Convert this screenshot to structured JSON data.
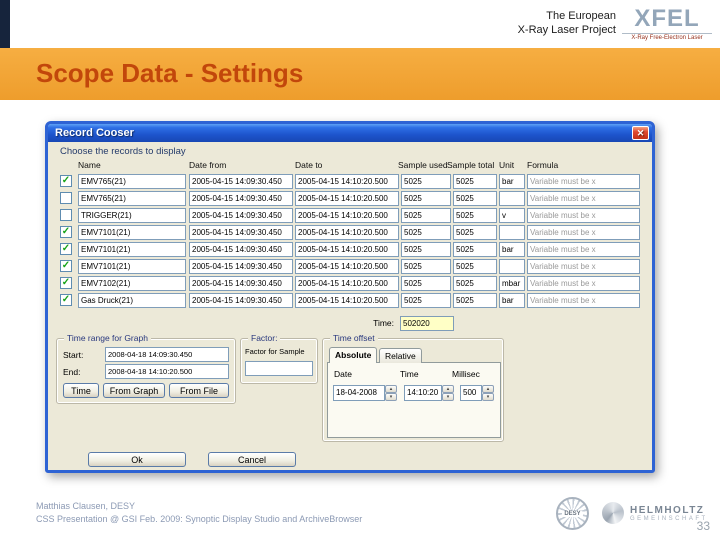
{
  "header": {
    "project_line1": "The European",
    "project_line2": "X-Ray Laser Project",
    "logo_text": "XFEL",
    "logo_caption": "X-Ray Free-Electron Laser",
    "title": "Scope Data - Settings"
  },
  "dialog": {
    "title": "Record Cooser",
    "close_glyph": "✕",
    "instruction": "Choose the records to display",
    "table": {
      "headers": [
        "Name",
        "Date from",
        "Date to",
        "Sample used",
        "Sample total",
        "Unit",
        "Formula"
      ],
      "rows": [
        {
          "checked": true,
          "name": "EMV765(21)",
          "date_from": "2005-04-15 14:09:30.450",
          "date_to": "2005-04-15 14:10:20.500",
          "sample_used": "5025",
          "sample_total": "5025",
          "unit": "bar",
          "formula": "Variable must be x"
        },
        {
          "checked": false,
          "name": "EMV765(21)",
          "date_from": "2005-04-15 14:09:30.450",
          "date_to": "2005-04-15 14:10:20.500",
          "sample_used": "5025",
          "sample_total": "5025",
          "unit": "",
          "formula": "Variable must be x"
        },
        {
          "checked": false,
          "name": "TRIGGER(21)",
          "date_from": "2005-04-15 14:09:30.450",
          "date_to": "2005-04-15 14:10:20.500",
          "sample_used": "5025",
          "sample_total": "5025",
          "unit": "v",
          "formula": "Variable must be x"
        },
        {
          "checked": true,
          "name": "EMV7101(21)",
          "date_from": "2005-04-15 14:09:30.450",
          "date_to": "2005-04-15 14:10:20.500",
          "sample_used": "5025",
          "sample_total": "5025",
          "unit": "",
          "formula": "Variable must be x"
        },
        {
          "checked": true,
          "name": "EMV7101(21)",
          "date_from": "2005-04-15 14:09:30.450",
          "date_to": "2005-04-15 14:10:20.500",
          "sample_used": "5025",
          "sample_total": "5025",
          "unit": "bar",
          "formula": "Variable must be x"
        },
        {
          "checked": true,
          "name": "EMV7101(21)",
          "date_from": "2005-04-15 14:09:30.450",
          "date_to": "2005-04-15 14:10:20.500",
          "sample_used": "5025",
          "sample_total": "5025",
          "unit": "",
          "formula": "Variable must be x"
        },
        {
          "checked": true,
          "name": "EMV7102(21)",
          "date_from": "2005-04-15 14:09:30.450",
          "date_to": "2005-04-15 14:10:20.500",
          "sample_used": "5025",
          "sample_total": "5025",
          "unit": "mbar",
          "formula": "Variable must be x"
        },
        {
          "checked": true,
          "name": "Gas Druck(21)",
          "date_from": "2005-04-15 14:09:30.450",
          "date_to": "2005-04-15 14:10:20.500",
          "sample_used": "5025",
          "sample_total": "5025",
          "unit": "bar",
          "formula": "Variable must be x"
        }
      ]
    },
    "time_label": "Time:",
    "time_value": "502020",
    "time_range_group": {
      "label": "Time range for Graph",
      "start_label": "Start:",
      "start_value": "2008-04-18 14:09:30.450",
      "end_label": "End:",
      "end_value": "2008-04-18 14:10:20.500",
      "time_button": "Time",
      "from_graph_button": "From Graph",
      "from_file_button": "From File"
    },
    "factor_group": {
      "label": "Factor:",
      "caption": "Factor for Sample",
      "value": ""
    },
    "time_offset_group": {
      "label": "Time offset",
      "tab_absolute": "Absolute",
      "tab_relative": "Relative",
      "date_label": "Date",
      "date_value": "18-04-2008",
      "time_label": "Time",
      "time_value": "14:10:20",
      "millisec_label": "Millisec",
      "millisec_value": "500"
    },
    "ok_button": "Ok",
    "cancel_button": "Cancel"
  },
  "footer": {
    "author": "Matthias Clausen, DESY",
    "event": "CSS Presentation @ GSI Feb. 2009: Synoptic Display Studio and ArchiveBrowser",
    "desy_label": "DESY",
    "helmholtz_line1": "HELMHOLTZ",
    "helmholtz_line2": "GEMEINSCHAFT",
    "page_number": "33"
  },
  "colors": {
    "band_orange": "#F2A438",
    "title_color": "#C2470B",
    "titlebar_blue": "#2E63D4",
    "field_border": "#7F9DB9",
    "highlight_yellow": "#FFFFC6",
    "accent_navy": "#16243C"
  }
}
